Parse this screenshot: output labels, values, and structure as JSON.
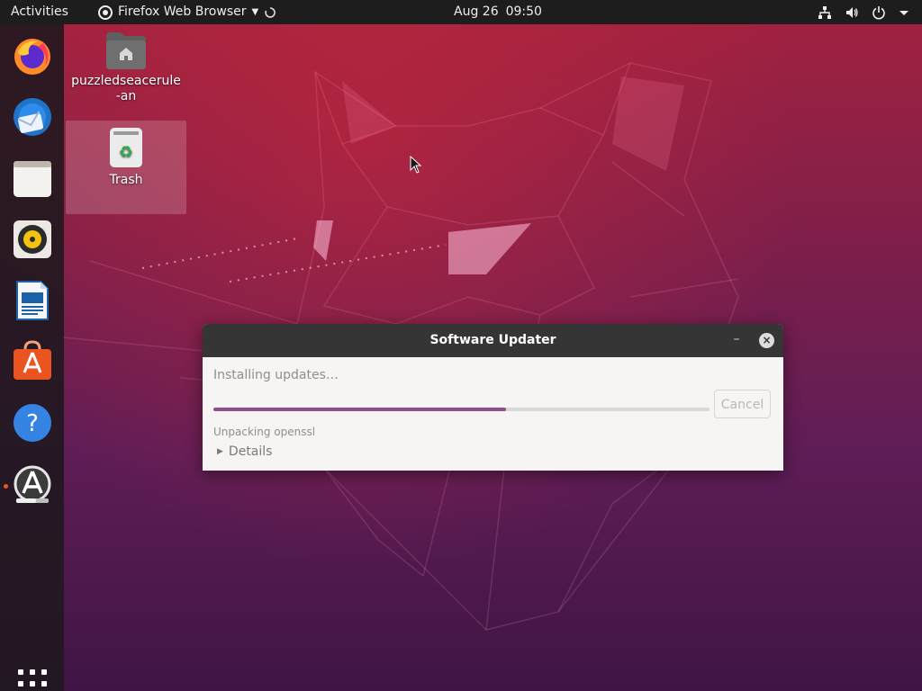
{
  "top_bar": {
    "activities": "Activities",
    "app_name": "Firefox Web Browser",
    "date": "Aug 26",
    "time": "09:50"
  },
  "dock": {
    "items": [
      {
        "name": "Firefox",
        "icon": "firefox-icon"
      },
      {
        "name": "Thunderbird",
        "icon": "thunderbird-icon"
      },
      {
        "name": "Files",
        "icon": "files-icon"
      },
      {
        "name": "Rhythmbox",
        "icon": "rhythmbox-icon"
      },
      {
        "name": "LibreOffice Writer",
        "icon": "writer-icon"
      },
      {
        "name": "Ubuntu Software",
        "icon": "software-icon"
      },
      {
        "name": "Help",
        "icon": "help-icon"
      },
      {
        "name": "Software Updater",
        "icon": "updater-icon"
      }
    ],
    "show_apps_icon": "grid-icon"
  },
  "desktop": {
    "home_folder_label": "puzzledseacerule-an",
    "trash_label": "Trash"
  },
  "dialog": {
    "title": "Software Updater",
    "minimize": "–",
    "close": "×",
    "status": "Installing updates…",
    "progress_percent": 59,
    "cancel_label": "Cancel",
    "current_action": "Unpacking openssl",
    "details_label": "Details"
  },
  "colors": {
    "accent_purple": "#924d8b",
    "ubuntu_orange": "#e95420",
    "top_bar": "#1d1d1d",
    "dialog_titlebar": "#353535"
  }
}
